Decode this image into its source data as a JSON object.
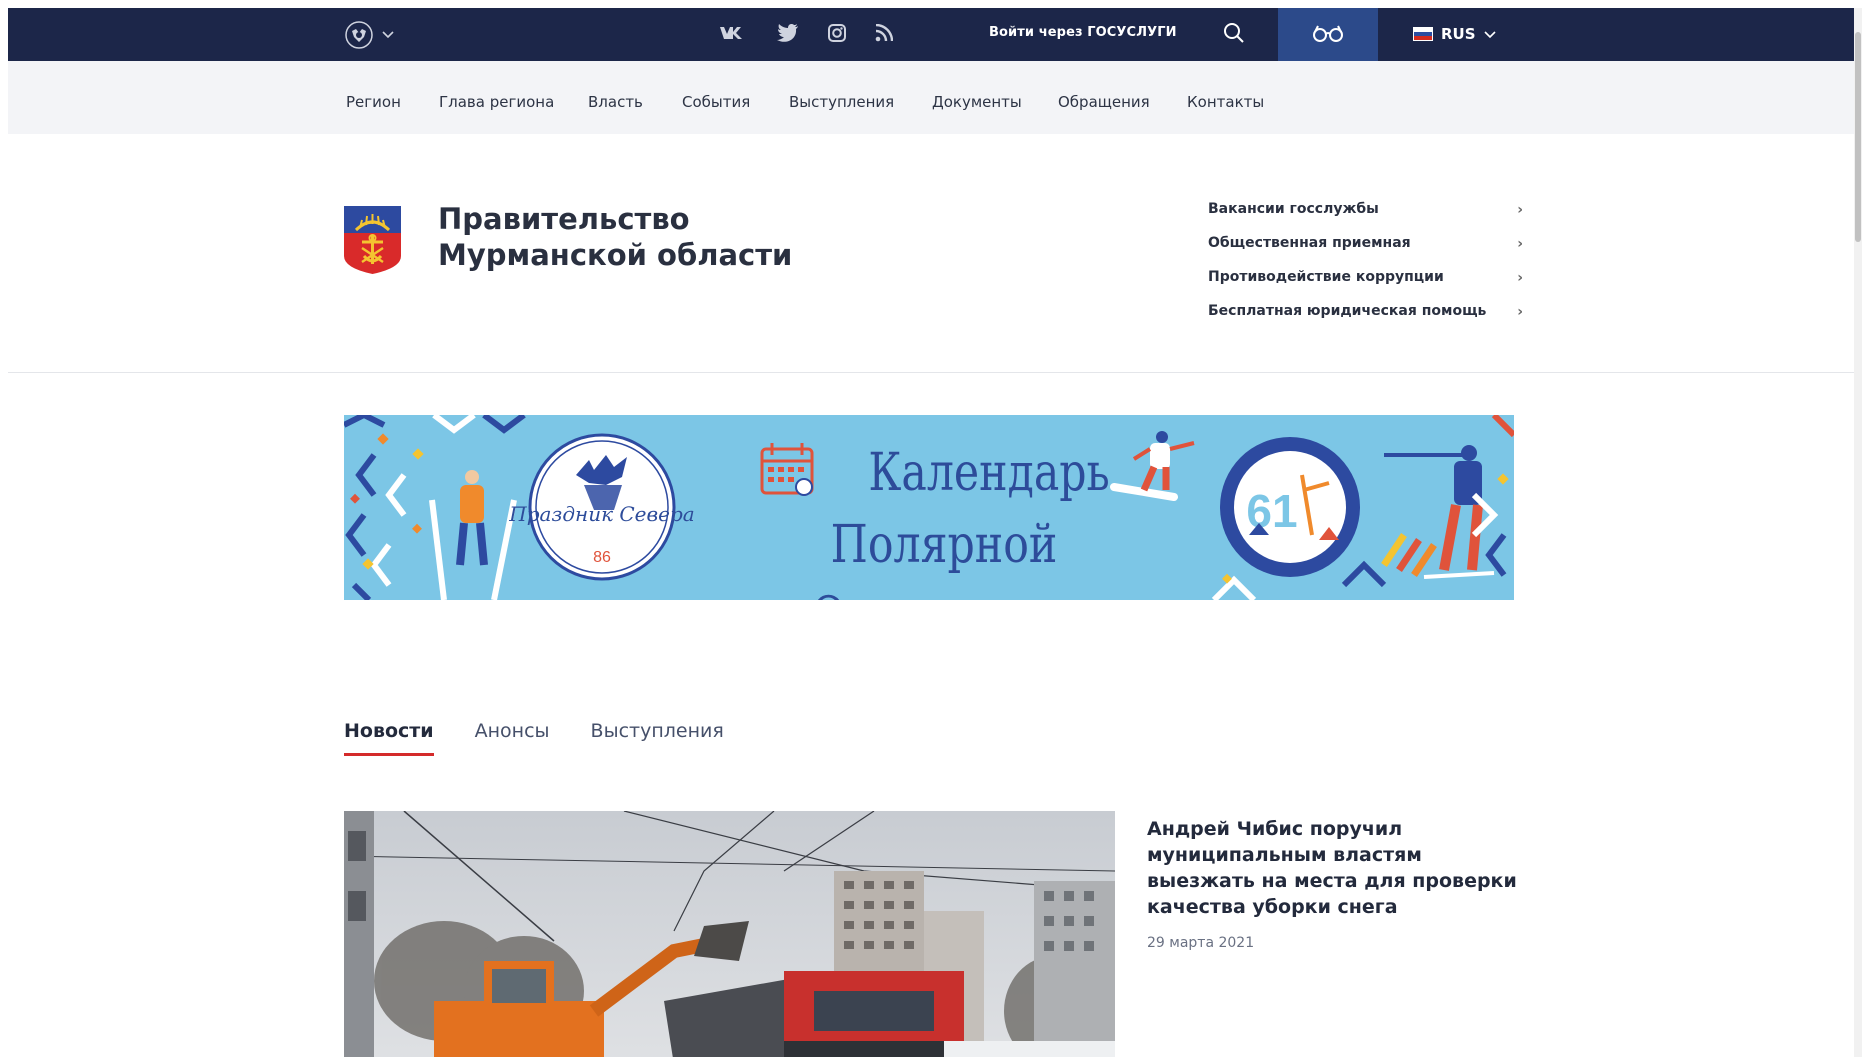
{
  "topbar": {
    "emblem_icon": "russia-eagle-emblem-icon",
    "social": [
      "vk-icon",
      "twitter-icon",
      "instagram-icon",
      "rss-icon"
    ],
    "gosuslugi_label": "Войти через ГОСУСЛУГИ",
    "search_icon": "search-icon",
    "vision_icon": "glasses-icon",
    "language": "RUS",
    "colors": {
      "bar": "#1c2649",
      "vision_button": "#2c4a8a"
    }
  },
  "nav": {
    "items": [
      "Регион",
      "Глава региона",
      "Власть",
      "События",
      "Выступления",
      "Документы",
      "Обращения",
      "Контакты"
    ]
  },
  "header": {
    "title_line1": "Правительство",
    "title_line2": "Мурманской области",
    "coat_icon": "murmansk-coat-of-arms-icon",
    "quick_links": [
      "Вакансии госслужбы",
      "Общественная приемная",
      "Противодействие коррупции",
      "Бесплатная юридическая помощь"
    ]
  },
  "banner": {
    "line1": "Календарь",
    "line2": "Полярной Олимпиады",
    "badge_left_text": "Праздник Севера",
    "badge_left_number": "86",
    "badge_right_number": "61",
    "colors": {
      "background": "#7cc6e6",
      "text": "#2d4c9a"
    }
  },
  "tabs": {
    "items": [
      "Новости",
      "Анонсы",
      "Выступления"
    ],
    "active": "Новости",
    "accent": "#d42a2a"
  },
  "news": {
    "title": "Андрей Чибис поручил муниципальным властям выезжать на места для проверки качества уборки снега",
    "date": "29 марта 2021"
  }
}
